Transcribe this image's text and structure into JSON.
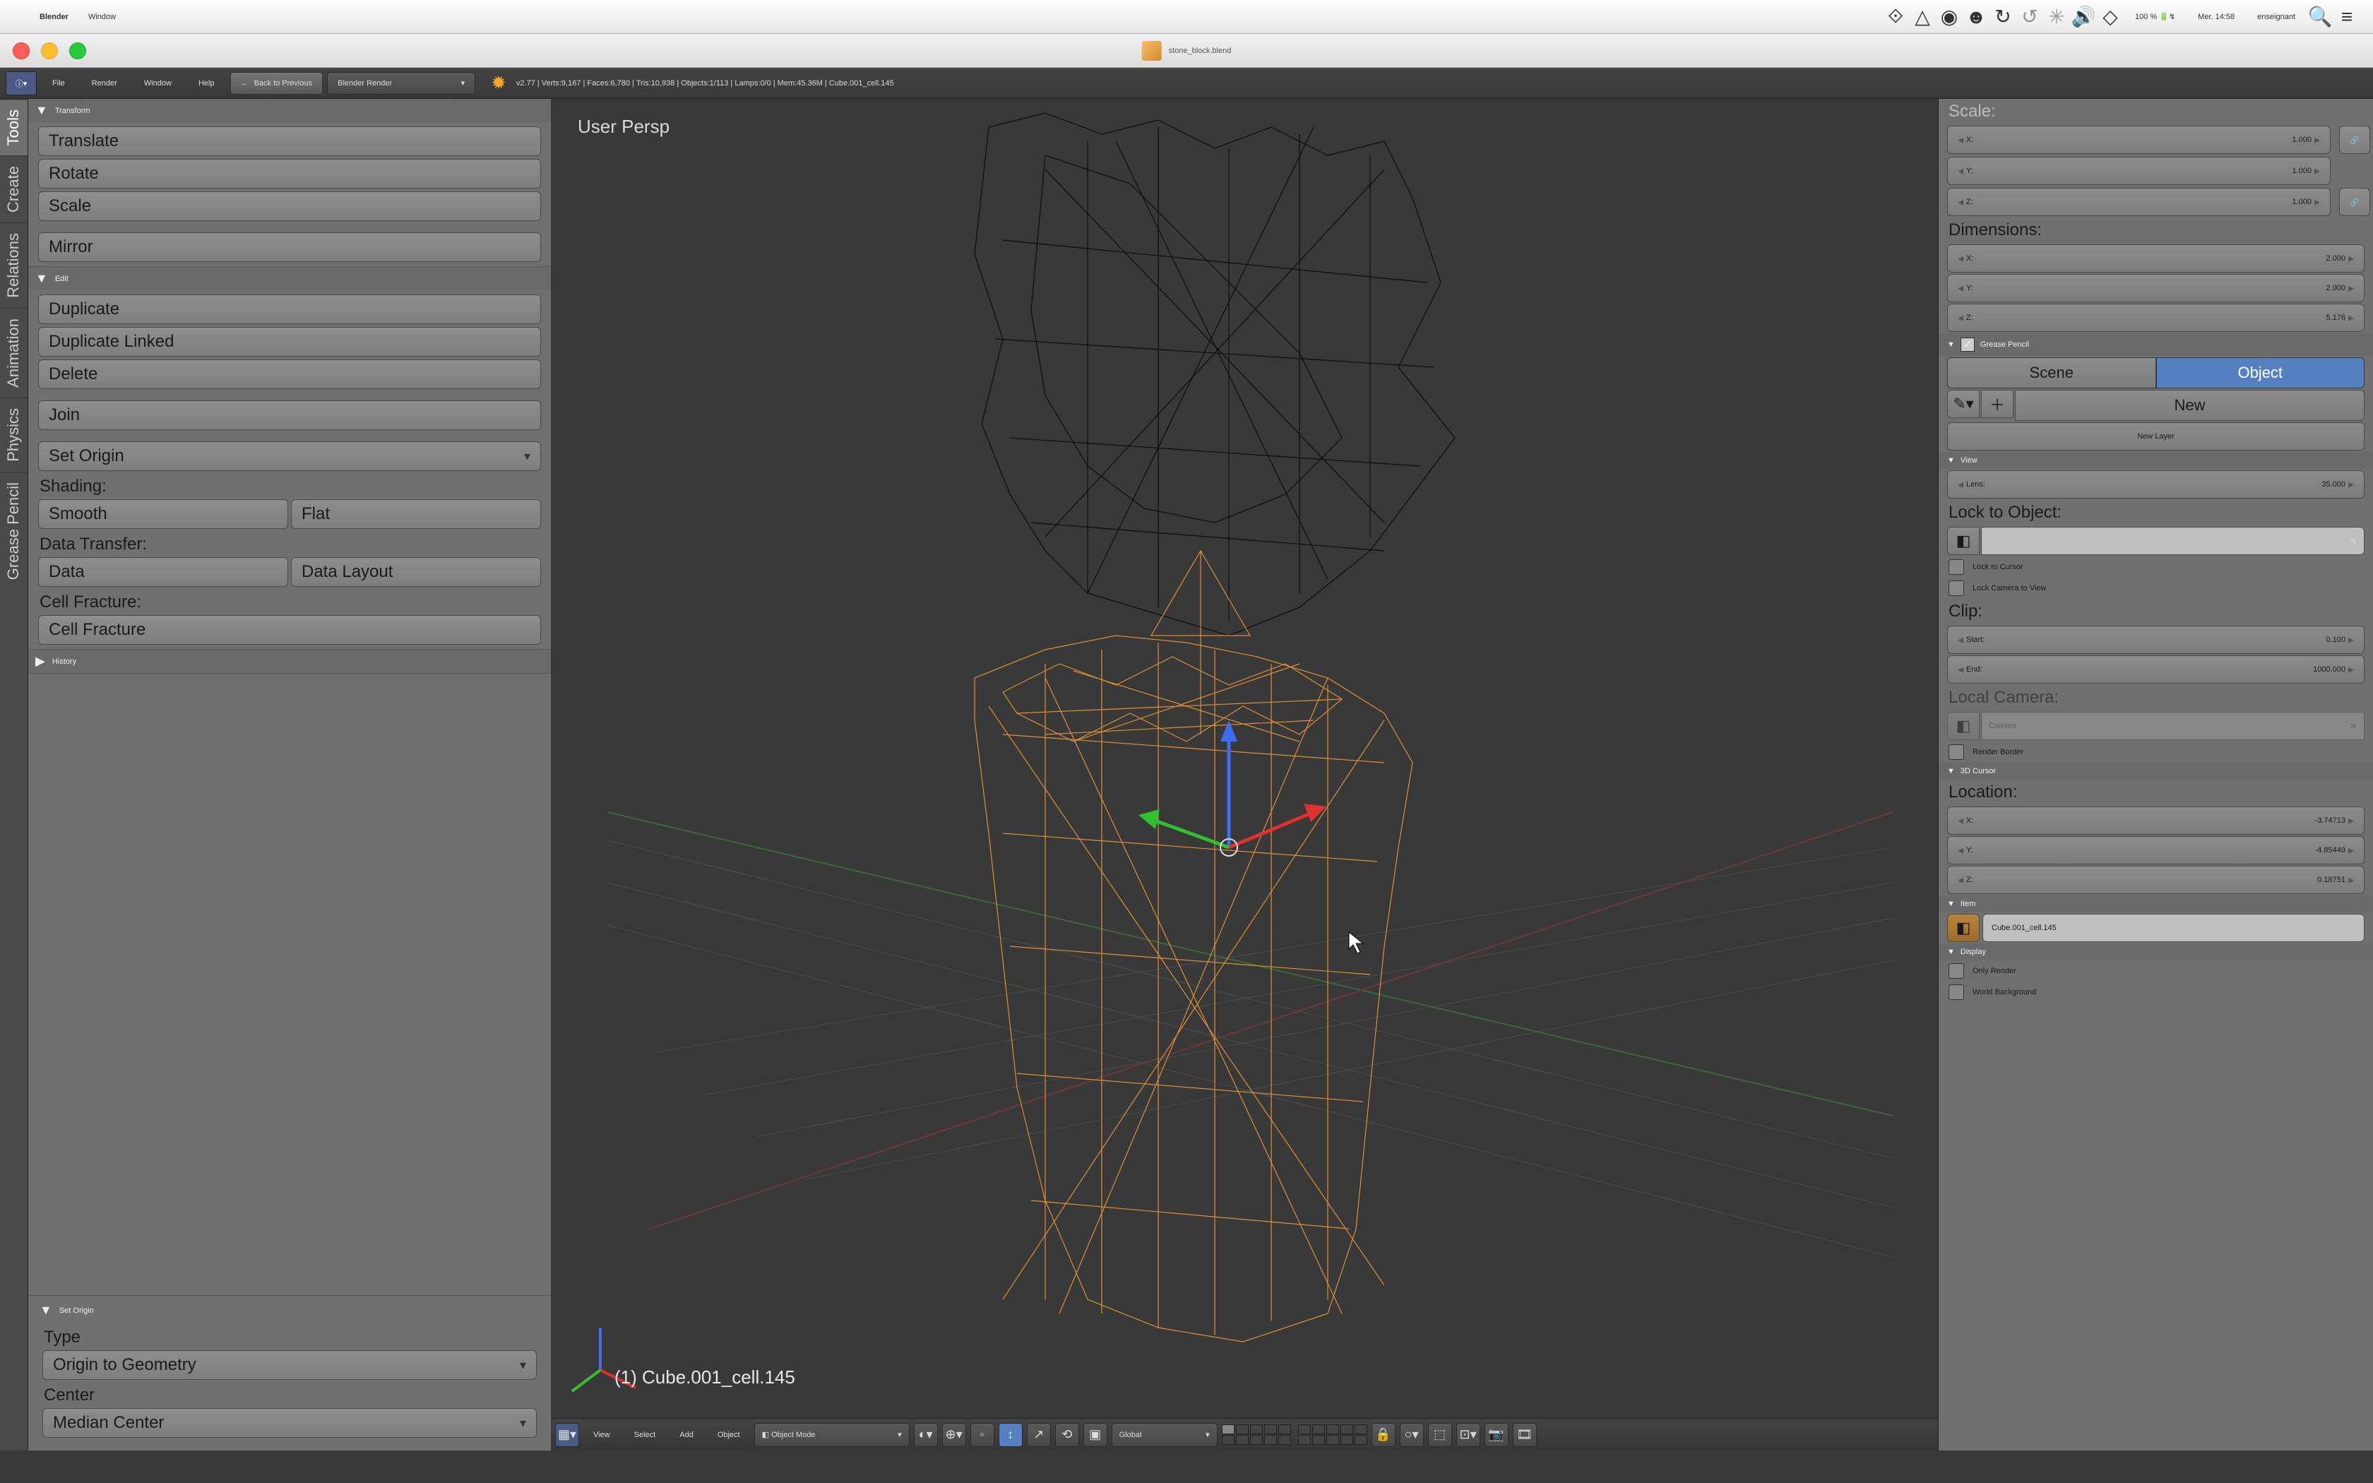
{
  "mac": {
    "app": "Blender",
    "menus": [
      "Window"
    ],
    "battery": "100 %",
    "day": "Mer.",
    "time": "14:58",
    "user": "enseignant"
  },
  "window": {
    "title": "stone_block.blend"
  },
  "info": {
    "menus": [
      "File",
      "Render",
      "Window",
      "Help"
    ],
    "back": "Back to Previous",
    "engine": "Blender Render",
    "stats": "v2.77 | Verts:9,167 | Faces:6,780 | Tris:10,938 | Objects:1/113 | Lamps:0/0 | Mem:45.36M | Cube.001_cell.145"
  },
  "tooltabs": [
    "Tools",
    "Create",
    "Relations",
    "Animation",
    "Physics",
    "Grease Pencil"
  ],
  "left": {
    "transform": {
      "h": "Transform",
      "translate": "Translate",
      "rotate": "Rotate",
      "scale": "Scale",
      "mirror": "Mirror"
    },
    "edit": {
      "h": "Edit",
      "duplicate": "Duplicate",
      "duplink": "Duplicate Linked",
      "delete": "Delete",
      "join": "Join",
      "setorigin": "Set Origin",
      "shading": "Shading:",
      "smooth": "Smooth",
      "flat": "Flat",
      "datatransfer": "Data Transfer:",
      "data": "Data",
      "datalayout": "Data Layout",
      "cellfrac": "Cell Fracture:",
      "cellfracbtn": "Cell Fracture"
    },
    "history": "History"
  },
  "operator": {
    "h": "Set Origin",
    "type_l": "Type",
    "type": "Origin to Geometry",
    "center_l": "Center",
    "center": "Median Center"
  },
  "viewport": {
    "persp": "User Persp",
    "obj": "(1) Cube.001_cell.145"
  },
  "right": {
    "scale_h": "Scale:",
    "scale": {
      "x": "1.000",
      "y": "1.000",
      "z": "1.000"
    },
    "dim_h": "Dimensions:",
    "dim": {
      "x": "2.000",
      "y": "2.000",
      "z": "5.176"
    },
    "gp": {
      "h": "Grease Pencil",
      "scene": "Scene",
      "object": "Object",
      "new": "New",
      "newlayer": "New Layer"
    },
    "view": {
      "h": "View",
      "lens_l": "Lens:",
      "lens": "35.000",
      "lockobj": "Lock to Object:",
      "lockcur": "Lock to Cursor",
      "lockcam": "Lock Camera to View",
      "clip": "Clip:",
      "start_l": "Start:",
      "start": "0.100",
      "end_l": "End:",
      "end": "1000.000",
      "localcam": "Local Camera:",
      "camera": "Camera",
      "renderborder": "Render Border"
    },
    "cursor": {
      "h": "3D Cursor",
      "loc": "Location:",
      "x": "-3.74713",
      "y": "-4.85449",
      "z": "0.18751"
    },
    "item": {
      "h": "Item",
      "name": "Cube.001_cell.145"
    },
    "display": {
      "h": "Display",
      "only": "Only Render",
      "world": "World Background"
    }
  },
  "viewheader": {
    "menus": [
      "View",
      "Select",
      "Add",
      "Object"
    ],
    "mode": "Object Mode",
    "orient": "Global"
  }
}
